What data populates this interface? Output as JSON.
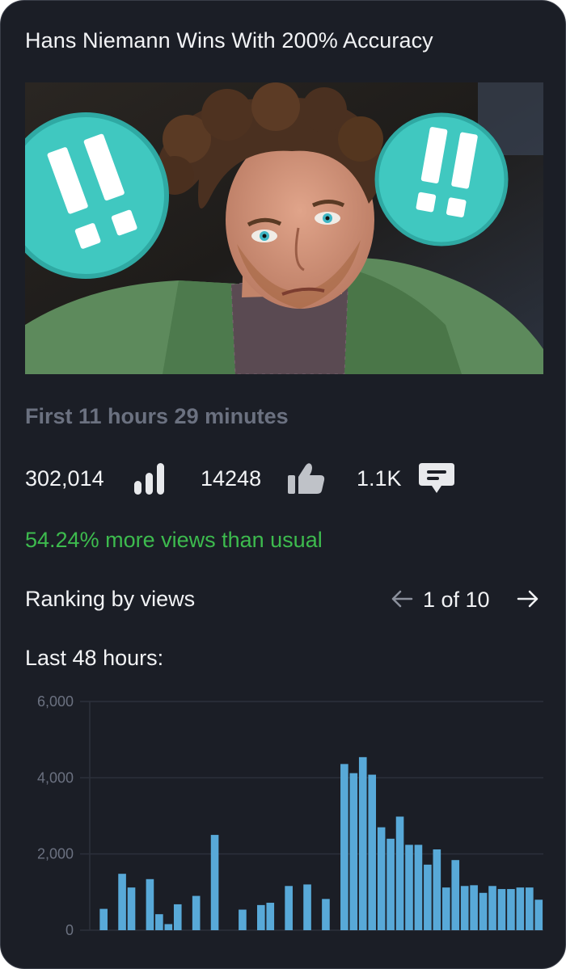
{
  "video": {
    "title": "Hans Niemann Wins With 200% Accuracy"
  },
  "period": {
    "label": "First 11 hours 29 minutes"
  },
  "stats": {
    "views": "302,014",
    "views_icon": "bar-chart-icon",
    "likes": "14248",
    "likes_icon": "thumbs-up-icon",
    "comments": "1.1K",
    "comments_icon": "comment-icon"
  },
  "performance": {
    "text": "54.24% more views than usual"
  },
  "ranking": {
    "label": "Ranking by views",
    "page": "1 of 10",
    "prev_icon": "arrow-left-icon",
    "next_icon": "arrow-right-icon"
  },
  "chart_label": "Last 48 hours:",
  "colors": {
    "background": "#1b1e26",
    "bar": "#58a9d8",
    "positive": "#3dbb4e",
    "muted": "#6b7180"
  },
  "chart_data": {
    "type": "bar",
    "title": "",
    "xlabel": "",
    "ylabel": "",
    "ylim": [
      0,
      6000
    ],
    "yticks": [
      "0",
      "2,000",
      "4,000",
      "6,000"
    ],
    "ytick_values": [
      0,
      2000,
      4000,
      6000
    ],
    "grid": true,
    "values": [
      0,
      560,
      0,
      1480,
      1120,
      0,
      1340,
      420,
      160,
      680,
      0,
      900,
      0,
      2500,
      0,
      0,
      540,
      0,
      660,
      720,
      0,
      1160,
      0,
      1200,
      0,
      820,
      0,
      4360,
      4120,
      4540,
      4080,
      2700,
      2400,
      2980,
      2240,
      2240,
      1720,
      2120,
      1120,
      1840,
      1160,
      1180,
      980,
      1160,
      1080,
      1080,
      1120,
      1120,
      800
    ]
  }
}
